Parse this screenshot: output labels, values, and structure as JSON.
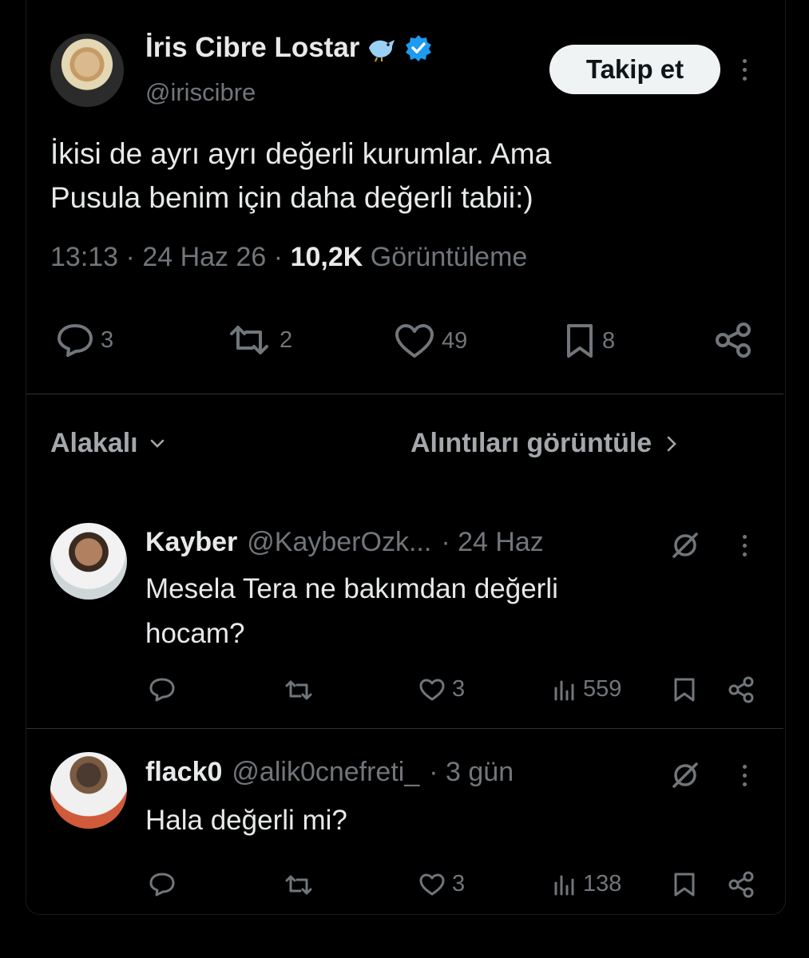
{
  "main_tweet": {
    "author_name": "İris Cibre Lostar",
    "handle": "@iriscibre",
    "follow_label": "Takip et",
    "text_line1": "İkisi de ayrı ayrı değerli kurumlar. Ama",
    "text_line2": "Pusula benim için daha değerli tabii:)",
    "time": "13:13",
    "date": "24 Haz 26",
    "views_count": "10,2K",
    "views_label": "Görüntüleme",
    "replies": "3",
    "retweets": "2",
    "likes": "49",
    "bookmarks": "8"
  },
  "replies_header": {
    "sort_label": "Alakalı",
    "quotes_label": "Alıntıları görüntüle"
  },
  "replies": [
    {
      "name": "Kayber",
      "handle": "@KayberOzk...",
      "time": "· 24 Haz",
      "text_line1": "Mesela Tera ne bakımdan değerli",
      "text_line2": "hocam?",
      "likes": "3",
      "views": "559"
    },
    {
      "name": "flack0",
      "handle": "@alik0cnefreti_",
      "time": "· 3 gün",
      "text_line1": "Hala değerli mi?",
      "likes": "3",
      "views": "138"
    }
  ],
  "colors": {
    "background": "#000000",
    "text": "#e7e9ea",
    "muted": "#71767b",
    "verified": "#1d9bf0"
  }
}
